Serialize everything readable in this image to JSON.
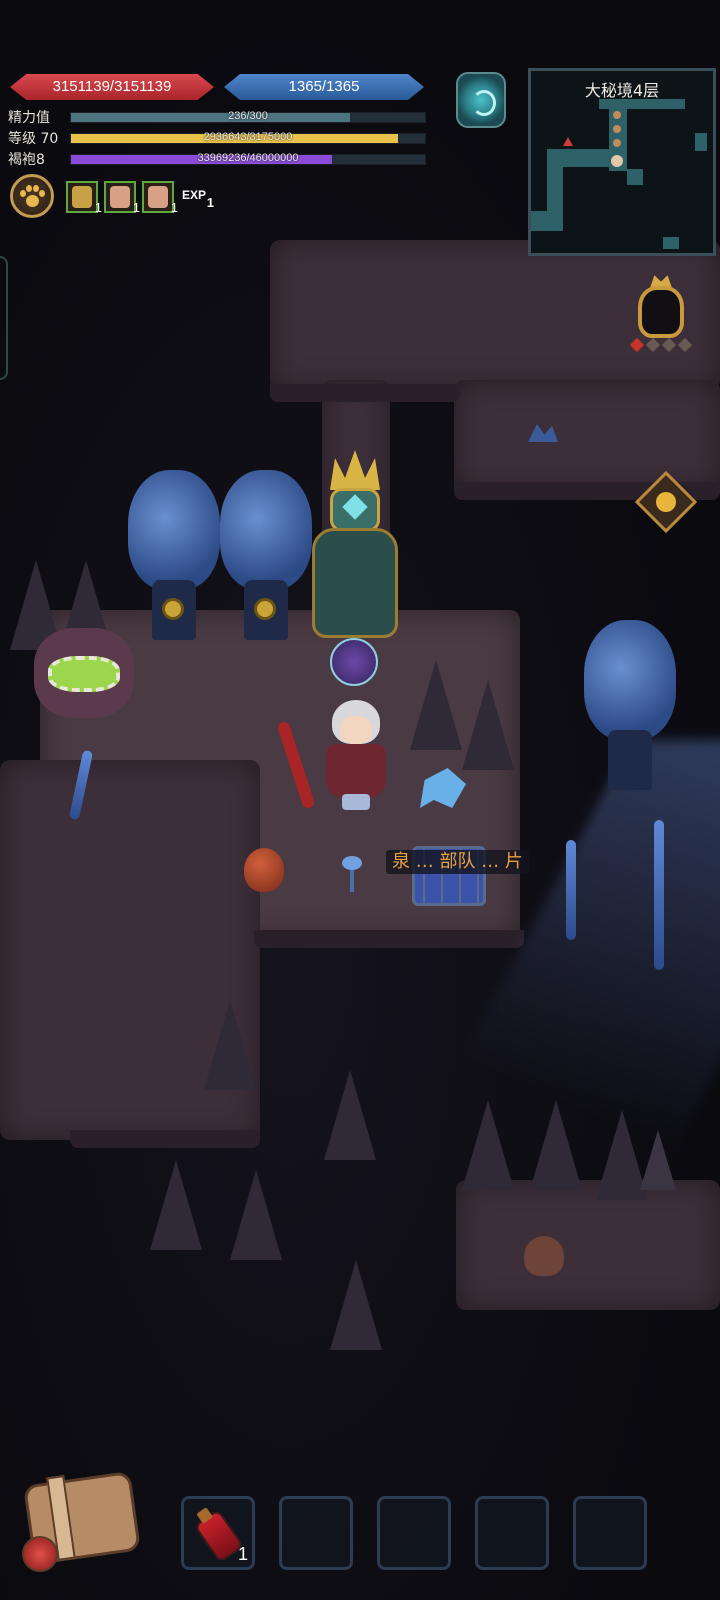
{
  "hud": {
    "hp": "3151139/3151139",
    "mp": "1365/1365",
    "stats": [
      {
        "label": "精力值",
        "value": "236/300",
        "fraction": 0.787,
        "color": "#4e7480"
      },
      {
        "label": "等级 70",
        "value": "2936643/3175000",
        "fraction": 0.925,
        "color": "#e8c24a"
      },
      {
        "label": "褐袍8",
        "value": "33969236/46000000",
        "fraction": 0.738,
        "color": "#8a4cd8"
      }
    ],
    "buffs": [
      {
        "icon": "armor-buff-icon",
        "count": "1",
        "color": "#c8a046"
      },
      {
        "icon": "shirt-buff-icon",
        "count": "1",
        "color": "#d8a084"
      },
      {
        "icon": "shirt-buff-icon",
        "count": "1",
        "color": "#d8a084"
      }
    ],
    "exp_buff": {
      "label": "EXP",
      "count": "1"
    },
    "pet_button_icon": "paw-icon",
    "portal_icon": "portal-icon"
  },
  "minimap": {
    "title": "大秘境4层",
    "player_marker": "player-face-icon",
    "target_marker": "red-triangle-icon"
  },
  "world": {
    "sign_text": "泉 … 部队 … 片",
    "npc_names": []
  },
  "right_side": {
    "trophy_icon": "trophy-icon",
    "compass_icon": "compass-icon"
  },
  "bottom": {
    "bag_icon": "backpack-icon",
    "slots": [
      {
        "item": "red-potion",
        "qty": "1"
      },
      {
        "item": "",
        "qty": ""
      },
      {
        "item": "",
        "qty": ""
      },
      {
        "item": "",
        "qty": ""
      },
      {
        "item": "",
        "qty": ""
      }
    ]
  }
}
